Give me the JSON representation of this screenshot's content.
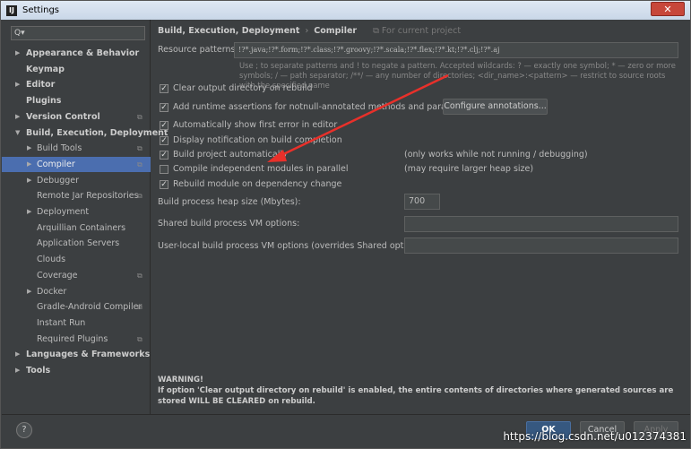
{
  "window": {
    "title": "Settings",
    "close": "✕",
    "app_icon": "IJ"
  },
  "sidebar": {
    "search_placeholder": "Q▾",
    "items": [
      {
        "label": "Appearance & Behavior",
        "arrow": "▶"
      },
      {
        "label": "Keymap",
        "arrow": ""
      },
      {
        "label": "Editor",
        "arrow": "▶"
      },
      {
        "label": "Plugins",
        "arrow": ""
      },
      {
        "label": "Version Control",
        "arrow": "▶"
      },
      {
        "label": "Build, Execution, Deployment",
        "arrow": "▼"
      },
      {
        "label": "Build Tools",
        "arrow": "▶"
      },
      {
        "label": "Compiler",
        "arrow": "▶"
      },
      {
        "label": "Debugger",
        "arrow": "▶"
      },
      {
        "label": "Remote Jar Repositories",
        "arrow": ""
      },
      {
        "label": "Deployment",
        "arrow": "▶"
      },
      {
        "label": "Arquillian Containers",
        "arrow": ""
      },
      {
        "label": "Application Servers",
        "arrow": ""
      },
      {
        "label": "Clouds",
        "arrow": ""
      },
      {
        "label": "Coverage",
        "arrow": ""
      },
      {
        "label": "Docker",
        "arrow": "▶"
      },
      {
        "label": "Gradle-Android Compiler",
        "arrow": ""
      },
      {
        "label": "Instant Run",
        "arrow": ""
      },
      {
        "label": "Required Plugins",
        "arrow": ""
      },
      {
        "label": "Languages & Frameworks",
        "arrow": "▶"
      },
      {
        "label": "Tools",
        "arrow": "▶"
      }
    ],
    "copy_icon": "⧉"
  },
  "main": {
    "breadcrumb": {
      "parent": "Build, Execution, Deployment",
      "sep": "›",
      "current": "Compiler",
      "scope": "⧉ For current project"
    },
    "resource_patterns": {
      "label": "Resource patterns:",
      "value": "!?*.java;!?*.form;!?*.class;!?*.groovy;!?*.scala;!?*.flex;!?*.kt;!?*.clj;!?*.aj",
      "hint": "Use ; to separate patterns and ! to negate a pattern. Accepted wildcards: ? — exactly one symbol; * — zero or more symbols; / — path separator; /**/ — any number of directories; <dir_name>:<pattern> — restrict to source roots with the specified name"
    },
    "checkboxes": [
      {
        "label": "Clear output directory on rebuild",
        "checked": true
      },
      {
        "label": "Add runtime assertions for notnull-annotated methods and parameters",
        "checked": true
      },
      {
        "label": "Automatically show first error in editor",
        "checked": true
      },
      {
        "label": "Display notification on build completion",
        "checked": true
      },
      {
        "label": "Build project automatically",
        "checked": true,
        "note": "(only works while not running / debugging)"
      },
      {
        "label": "Compile independent modules in parallel",
        "checked": false,
        "note": "(may require larger heap size)"
      },
      {
        "label": "Rebuild module on dependency change",
        "checked": true
      }
    ],
    "configure_button": "Configure annotations...",
    "heap": {
      "label": "Build process heap size (Mbytes):",
      "value": "700"
    },
    "shared_vm": {
      "label": "Shared build process VM options:",
      "value": ""
    },
    "user_vm": {
      "label": "User-local build process VM options (overrides Shared options):",
      "value": ""
    },
    "warning": {
      "title": "WARNING!",
      "text": "If option 'Clear output directory on rebuild' is enabled, the entire contents of directories where generated sources are stored WILL BE CLEARED on rebuild."
    }
  },
  "footer": {
    "help": "?",
    "ok": "OK",
    "cancel": "Cancel",
    "apply": "Apply",
    "watermark": "https://blog.csdn.net/u012374381"
  },
  "colors": {
    "accent": "#4b6eaf",
    "arrow": "#e8302a"
  }
}
